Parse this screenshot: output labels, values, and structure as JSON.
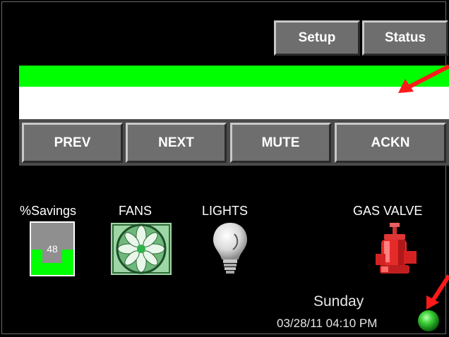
{
  "header": {
    "setup_label": "Setup",
    "status_label": "Status"
  },
  "alarm": {
    "bar_color": "#00ff00",
    "message": ""
  },
  "nav": {
    "prev": "PREV",
    "next": "NEXT",
    "mute": "MUTE",
    "ackn": "ACKN"
  },
  "status": {
    "savings_label": "%Savings",
    "savings_value": "48",
    "savings_level_percent": 48,
    "fans_label": "FANS",
    "lights_label": "LIGHTS",
    "gas_label": "GAS VALVE"
  },
  "clock": {
    "day": "Sunday",
    "datetime": "03/28/11  04:10 PM"
  },
  "indicator": {
    "color": "#3fd33a",
    "state": "on"
  },
  "annotations": {
    "arrow_color": "#ff1a1a"
  }
}
